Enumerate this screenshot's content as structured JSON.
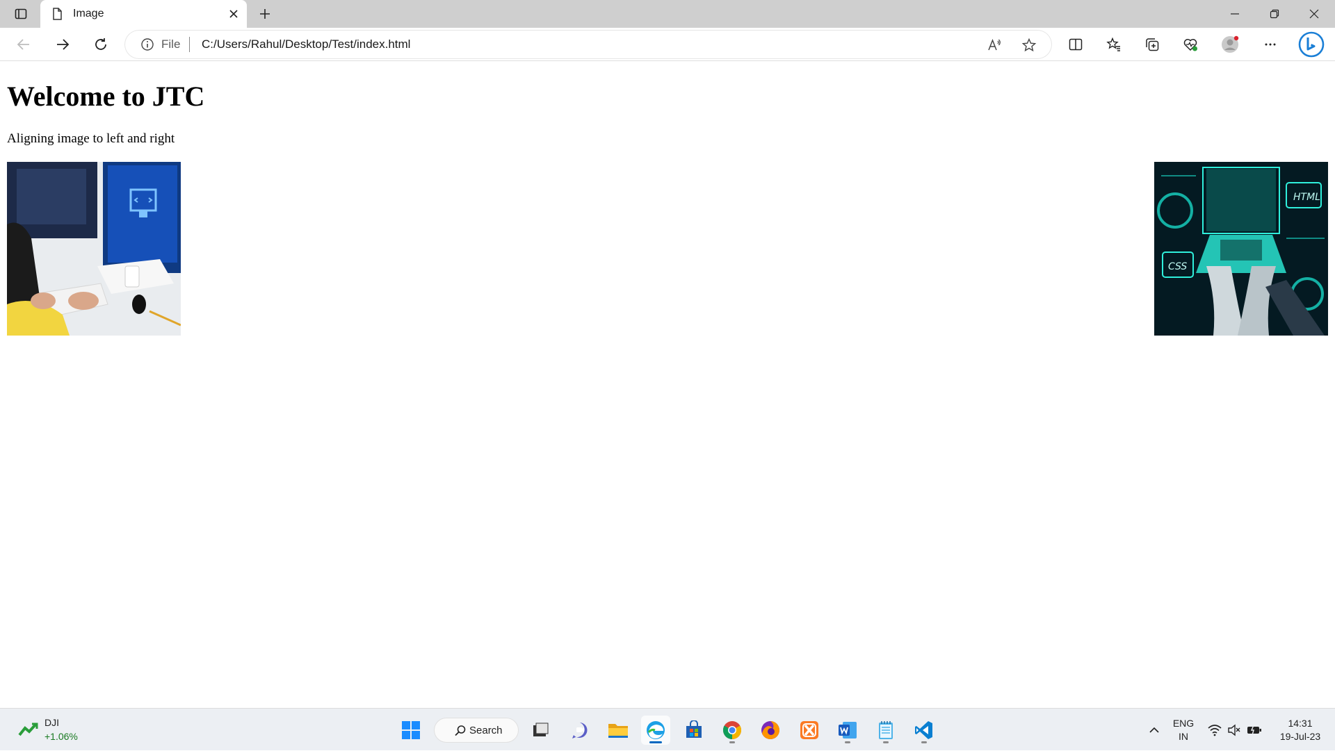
{
  "browser": {
    "tab": {
      "title": "Image"
    },
    "address": {
      "scheme": "File",
      "url": "C:/Users/Rahul/Desktop/Test/index.html"
    }
  },
  "page": {
    "heading": "Welcome to JTC",
    "paragraph": "Aligning image to left and right",
    "images": [
      {
        "name": "programmer-at-desk-image",
        "align": "left"
      },
      {
        "name": "laptop-html-css-image",
        "align": "right",
        "overlay_labels": [
          "HTML",
          "CSS"
        ]
      }
    ]
  },
  "taskbar": {
    "widget": {
      "name": "DJI",
      "change": "+1.06%"
    },
    "search_label": "Search",
    "apps": [
      "start-icon",
      "task-view-icon",
      "teams-chat-icon",
      "file-explorer-icon",
      "edge-icon",
      "store-icon",
      "chrome-icon",
      "firefox-icon",
      "xampp-icon",
      "word-icon",
      "notepad-icon",
      "vscode-icon"
    ],
    "language": {
      "line1": "ENG",
      "line2": "IN"
    },
    "clock": {
      "time": "14:31",
      "date": "19-Jul-23"
    }
  },
  "colors": {
    "accent": "#0067c0",
    "tabstrip": "#cfcfcf",
    "taskbar": "#eceff3",
    "gain": "#1a7a22"
  }
}
